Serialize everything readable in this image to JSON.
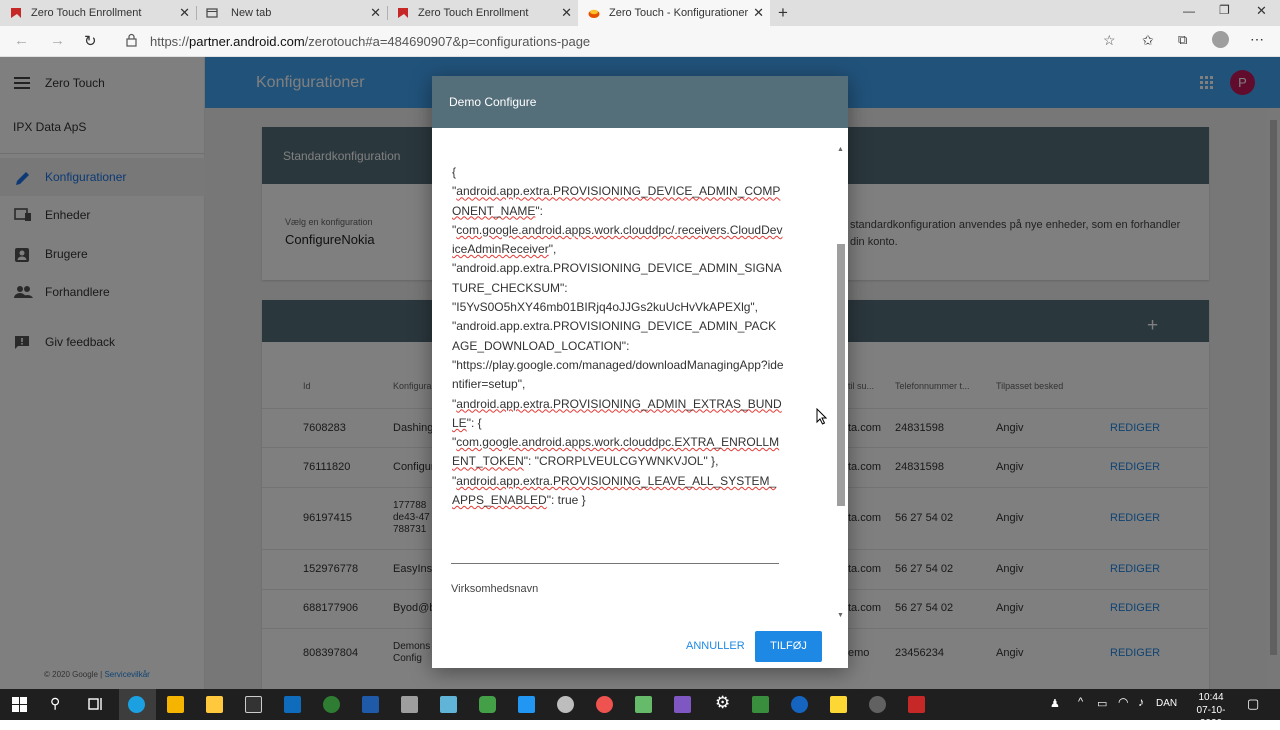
{
  "browser": {
    "tabs": [
      {
        "title": "Zero Touch Enrollment",
        "icon": "zero-touch-favicon-icon"
      },
      {
        "title": "New tab",
        "icon": "new-tab-favicon-icon"
      },
      {
        "title": "Zero Touch Enrollment",
        "icon": "zero-touch-favicon-icon"
      },
      {
        "title": "Zero Touch - Konfigurationer",
        "icon": "partner-favicon-icon"
      }
    ],
    "new_tab_symbol": "+",
    "url_prefix": "https://",
    "url_host": "partner.android.com",
    "url_rest": "/zerotouch#a=484690907&p=configurations-page"
  },
  "sidebar": {
    "app_title": "Zero Touch",
    "org_name": "IPX Data ApS",
    "items": [
      {
        "label": "Konfigurationer",
        "icon": "pencil-icon"
      },
      {
        "label": "Enheder",
        "icon": "devices-icon"
      },
      {
        "label": "Brugere",
        "icon": "user-card-icon"
      },
      {
        "label": "Forhandlere",
        "icon": "people-icon"
      },
      {
        "label": "Giv feedback",
        "icon": "feedback-icon"
      }
    ],
    "footer": "© 2020 Google | ",
    "footer_link": "Servicevilkår"
  },
  "appbar": {
    "title": "Konfigurationer",
    "avatar_letter": "P"
  },
  "default_config": {
    "title": "Standardkonfiguration",
    "select_label": "Vælg en konfiguration",
    "select_value": "ConfigureNokia",
    "description_1": "standardkonfiguration anvendes på nye enheder, som en forhandler",
    "description_2": "din konto."
  },
  "config_table": {
    "add_symbol": "+",
    "headers": {
      "id": "Id",
      "name": "Konfigura",
      "email": "til su...",
      "phone": "Telefonnummer t...",
      "message": "Tilpasset besked"
    },
    "edit_label": "REDIGER",
    "rows": [
      {
        "id": "7608283",
        "name": "Dashing",
        "email": "ta.com",
        "phone": "24831598",
        "message": "Angiv"
      },
      {
        "id": "76111820",
        "name": "Configur",
        "email": "ta.com",
        "phone": "24831598",
        "message": "Angiv"
      },
      {
        "id": "96197415",
        "name": "177788",
        "name2": "de43-47",
        "name3": "788731",
        "email": "ta.com",
        "phone": "56 27 54 02",
        "message": "Angiv"
      },
      {
        "id": "152976778",
        "name": "EasyInst",
        "email": "ta.com",
        "phone": "56 27 54 02",
        "message": "Angiv"
      },
      {
        "id": "688177906",
        "name": "Byod@b",
        "email": "ta.com",
        "phone": "56 27 54 02",
        "message": "Angiv"
      },
      {
        "id": "808397804",
        "name": "Demons",
        "name2": "Config",
        "email": "emo",
        "phone": "23456234",
        "message": "Angiv"
      }
    ]
  },
  "dialog": {
    "title": "Demo Configure",
    "json_open": "{",
    "json_lines": [
      {
        "pre": "\"",
        "sq": "android.app.extra.PROVISIONING_DEVICE_ADMIN_COMPONENT_NAME",
        "post": "\":"
      },
      {
        "pre": "\"",
        "sq": "com.google.android.apps.work.clouddpc/.receivers.CloudDeviceAdminReceiver",
        "post": "\","
      },
      {
        "pre": "\"android.app.extra.PROVISIONING_DEVICE_ADMIN_SIGNATURE_CHECKSUM\":",
        "sq": "",
        "post": ""
      },
      {
        "pre": "\"I5YvS0O5hXY46mb01BIRjq4oJJGs2kuUcHvVkAPEXlg\",",
        "sq": "",
        "post": ""
      },
      {
        "pre": "\"android.app.extra.PROVISIONING_DEVICE_ADMIN_PACKAGE_DOWNLOAD_LOCATION\":",
        "sq": "",
        "post": ""
      },
      {
        "pre": "\"https://play.google.com/managed/downloadManagingApp?identifier=setup\",",
        "sq": "",
        "post": ""
      },
      {
        "pre": "\"",
        "sq": "android.app.extra.PROVISIONING_ADMIN_EXTRAS_BUNDLE",
        "post": "\": {"
      },
      {
        "pre": "\"",
        "sq": "com.google.android.apps.work.clouddpc.EXTRA_ENROLLMENT_TOKEN",
        "post": "\": \"CRORPLVEULCGYWNKVJOL\" },"
      },
      {
        "pre": "\"",
        "sq": "android.app.extra.PROVISIONING_LEAVE_ALL_SYSTEM_APPS_ENABLED",
        "post": "\": true }"
      }
    ],
    "company_label": "Virksomhedsnavn",
    "cancel_label": "ANNULLER",
    "add_label": "TILFØJ"
  },
  "taskbar": {
    "language": "DAN",
    "time": "10:44",
    "date": "07-10-2020"
  },
  "colors": {
    "appbar": "#42a5f5",
    "header_slate": "#546e7a",
    "accent": "#1e88e5",
    "avatar": "#c2185b"
  }
}
